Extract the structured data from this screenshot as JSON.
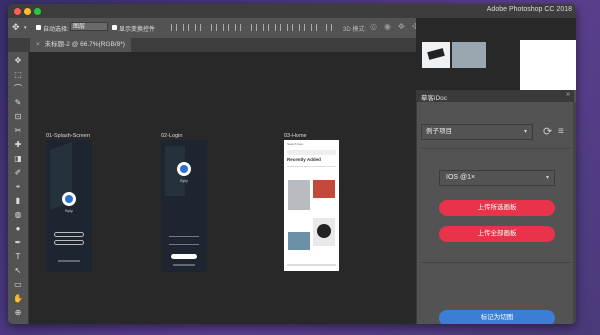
{
  "window": {
    "app_title": "Adobe Photoshop CC 2018"
  },
  "options_bar": {
    "auto_select_label": "自动选择:",
    "layer_select_value": "图层",
    "show_transform_label": "显示变换控件",
    "mode_3d_label": "3D 模式:"
  },
  "document_tab": {
    "title": "未标题-2 @ 66.7%(RGB/8*)",
    "close_glyph": "×"
  },
  "artboards": [
    {
      "label": "01-Splash-Screen",
      "app_name": "Bply"
    },
    {
      "label": "02-Login",
      "app_name": "Bply"
    },
    {
      "label": "03-Home",
      "search_hint": "Search here",
      "section_title": "Recently Added"
    }
  ],
  "tools": [
    "✥",
    "⬚",
    "⌒",
    "✎",
    "⊡",
    "✂",
    "✚",
    "◨",
    "✐",
    "⌖",
    "▮",
    "◍",
    "●",
    "✒",
    "T",
    "↖",
    "▭",
    "✋",
    "⊕"
  ],
  "panel": {
    "title": "摹客iDoc",
    "collapse_glyph": "»",
    "project_select": "例子项目",
    "platform_select": "IOS @1×",
    "upload_selected_button": "上传所选画板",
    "upload_all_button": "上传全部画板",
    "mark_slice_button": "标记为切图"
  },
  "colors": {
    "primary_button": "#e8334a",
    "slice_button": "#3a7fd5"
  }
}
